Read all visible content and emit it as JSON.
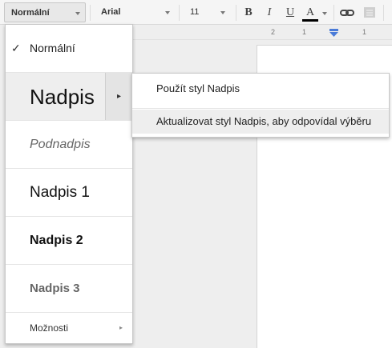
{
  "toolbar": {
    "style_value": "Normální",
    "font_value": "Arial",
    "size_value": "11",
    "bold_label": "B",
    "italic_label": "I",
    "underline_label": "U",
    "text_color_label": "A"
  },
  "ruler": {
    "ticks": [
      "2",
      "1",
      "1"
    ]
  },
  "style_menu": {
    "items": [
      {
        "label": "Normální",
        "checked": true
      },
      {
        "label": "Nadpis",
        "has_submenu": true
      },
      {
        "label": "Podnadpis"
      },
      {
        "label": "Nadpis 1"
      },
      {
        "label": "Nadpis 2"
      },
      {
        "label": "Nadpis 3"
      },
      {
        "label": "Možnosti",
        "has_submenu": true
      }
    ],
    "check_glyph": "✓",
    "submenu_arrow": "▸"
  },
  "submenu": {
    "items": [
      {
        "label": "Použít styl Nadpis"
      },
      {
        "label": "Aktualizovat styl Nadpis, aby odpovídal výběru"
      }
    ]
  }
}
